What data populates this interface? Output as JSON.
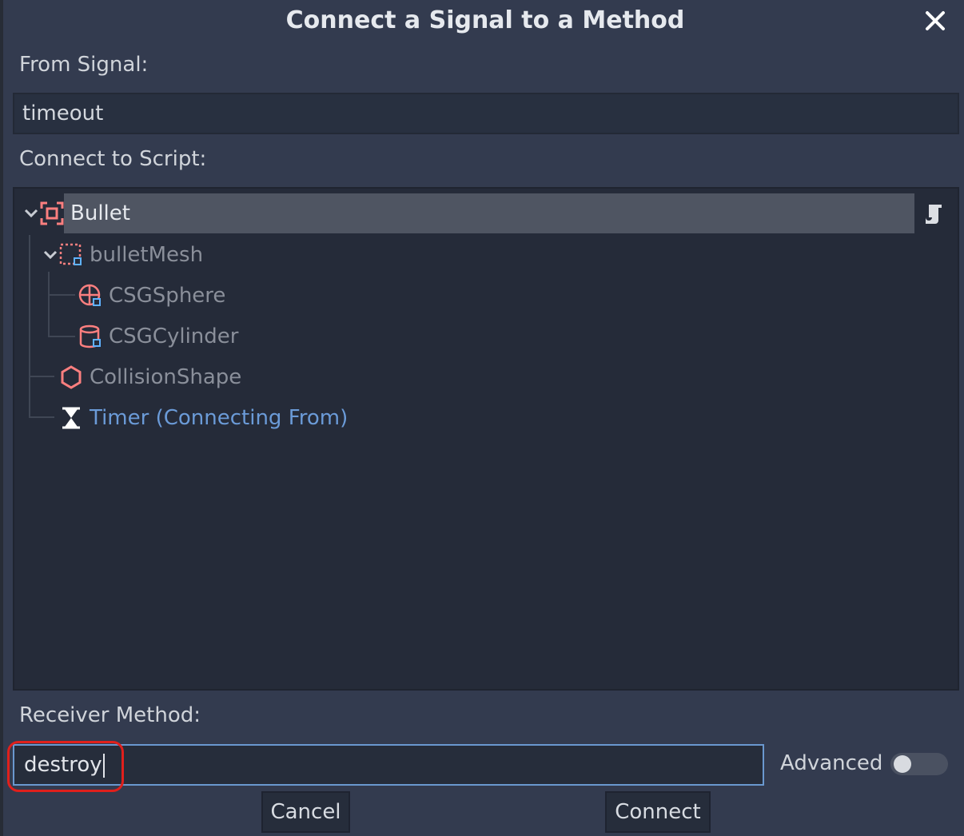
{
  "dialog": {
    "title": "Connect a Signal to a Method",
    "close_icon": "close-icon"
  },
  "from_signal": {
    "label": "From Signal:",
    "value": "timeout"
  },
  "connect_to_script": {
    "label": "Connect to Script:",
    "tree": [
      {
        "label": "Bullet",
        "icon": "kinematic-body-icon",
        "selected": true,
        "has_script": true
      },
      {
        "label": "bulletMesh",
        "icon": "csg-combiner-icon",
        "dim": true
      },
      {
        "label": "CSGSphere",
        "icon": "csg-sphere-icon",
        "dim": true
      },
      {
        "label": "CSGCylinder",
        "icon": "csg-cylinder-icon",
        "dim": true
      },
      {
        "label": "CollisionShape",
        "icon": "collision-shape-icon",
        "dim": true
      },
      {
        "label": "Timer (Connecting From)",
        "icon": "timer-icon",
        "connecting": true
      }
    ]
  },
  "receiver": {
    "label": "Receiver Method:",
    "value": "destroy"
  },
  "advanced": {
    "label": "Advanced",
    "enabled": false
  },
  "buttons": {
    "cancel": "Cancel",
    "connect": "Connect"
  },
  "colors": {
    "background": "#333b4f",
    "tree_background": "#252b39",
    "accent": "#6b9bd8",
    "node_icon": "#fc7f7f",
    "highlight": "#e0201c"
  }
}
